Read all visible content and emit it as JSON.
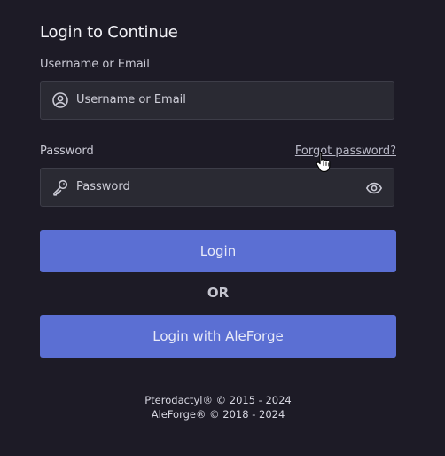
{
  "form": {
    "title": "Login to Continue",
    "username": {
      "label": "Username or Email",
      "placeholder": "Username or Email",
      "value": ""
    },
    "password": {
      "label": "Password",
      "placeholder": "Password",
      "value": "",
      "forgot_link": "Forgot password?"
    },
    "login_button": "Login",
    "separator": "OR",
    "aleforge_button": "Login with AleForge"
  },
  "footer": {
    "line1": "Pterodactyl® © 2015 - 2024",
    "line2": "AleForge® © 2018 - 2024"
  },
  "icons": {
    "username": "user-circle-icon",
    "password": "key-icon",
    "toggle_visibility": "eye-icon",
    "cursor": "hand-pointer-cursor"
  },
  "colors": {
    "background": "#1d1b26",
    "field_bg": "#2a2a33",
    "button_bg": "#5b6fd3"
  }
}
